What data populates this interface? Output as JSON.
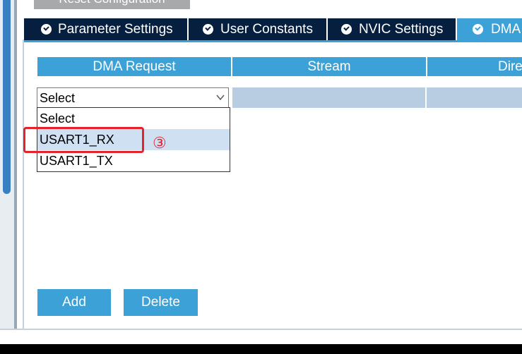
{
  "toolbar": {
    "reset_label": "Reset Configuration"
  },
  "tabs": [
    {
      "label": "Parameter Settings",
      "active": false
    },
    {
      "label": "User Constants",
      "active": false
    },
    {
      "label": "NVIC Settings",
      "active": false
    },
    {
      "label": "DMA",
      "active": true
    }
  ],
  "table": {
    "headers": [
      "DMA Request",
      "Stream",
      "Dire"
    ]
  },
  "select": {
    "value": "Select",
    "options": [
      "Select",
      "USART1_RX",
      "USART1_TX"
    ],
    "hovered_option": "USART1_RX"
  },
  "annotation": {
    "step_marker": "③",
    "color": "#e4232b"
  },
  "buttons": {
    "add_label": "Add",
    "delete_label": "Delete"
  },
  "colors": {
    "accent": "#3ba1d6",
    "tab_dark": "#061f3f",
    "row_fill": "#b8cde1"
  }
}
